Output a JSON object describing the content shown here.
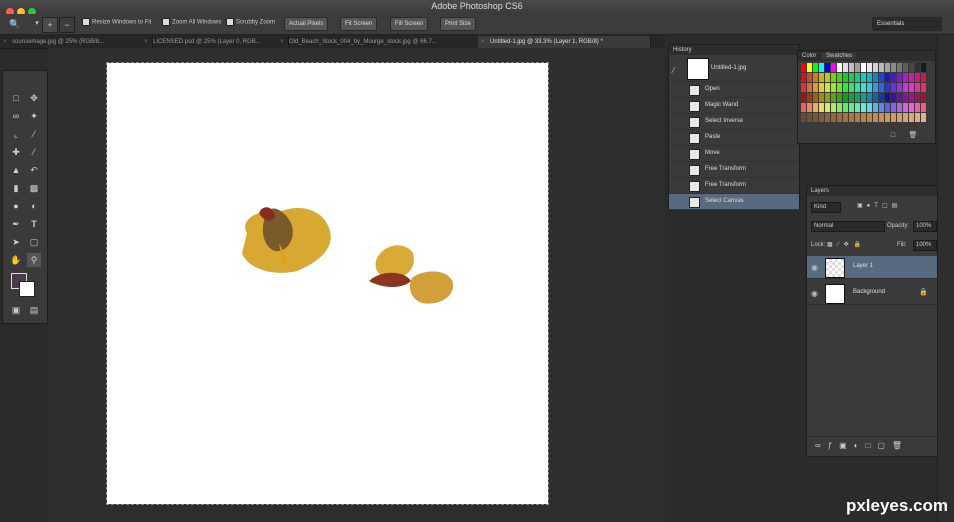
{
  "app": {
    "title": "Adobe Photoshop CS6",
    "window_controls": [
      "#ff5f57",
      "#febc2e",
      "#28c840"
    ]
  },
  "options_bar": {
    "tool_icon": "zoom-icon",
    "checks": [
      {
        "label": "Resize Windows to Fit",
        "checked": true
      },
      {
        "label": "Zoom All Windows",
        "checked": true
      },
      {
        "label": "Scrubby Zoom",
        "checked": true
      }
    ],
    "buttons": [
      "Actual Pixels",
      "Fit Screen",
      "Fill Screen",
      "Print Size"
    ],
    "workspace": "Essentials"
  },
  "document_tabs": [
    {
      "label": "sourceimage.jpg @ 25% (RGB/8...",
      "active": false
    },
    {
      "label": "LICENSED.psd @ 25% (Layer 0, RGB...",
      "active": false
    },
    {
      "label": "Old_Beach_Stock_004_by_Mourge_stock.jpg @ 66.7...",
      "active": false
    },
    {
      "label": "Untitled-1.jpg @ 33.3% (Layer 1, RGB/8) *",
      "active": true
    }
  ],
  "history_panel": {
    "title": "History",
    "snapshot": "Untitled-1.jpg",
    "items": [
      "Open",
      "Magic Wand",
      "Select Inverse",
      "Paste",
      "Move",
      "Free Transform",
      "Free Transform",
      "Select Canvas"
    ],
    "selected_index": 7
  },
  "swatches_panel": {
    "tabs": [
      "Color",
      "Swatches"
    ],
    "active_tab": "Swatches"
  },
  "layers_panel": {
    "title": "Layers",
    "kind": "Kind",
    "blend_mode": "Normal",
    "opacity_label": "Opacity:",
    "opacity_value": "100%",
    "lock_label": "Lock:",
    "fill_label": "Fill:",
    "fill_value": "100%",
    "layers": [
      {
        "name": "Layer 1",
        "selected": true,
        "thumb": "transparent"
      },
      {
        "name": "Background",
        "selected": false,
        "thumb": "white",
        "locked": true
      }
    ]
  },
  "watermark": "pxleyes.com"
}
